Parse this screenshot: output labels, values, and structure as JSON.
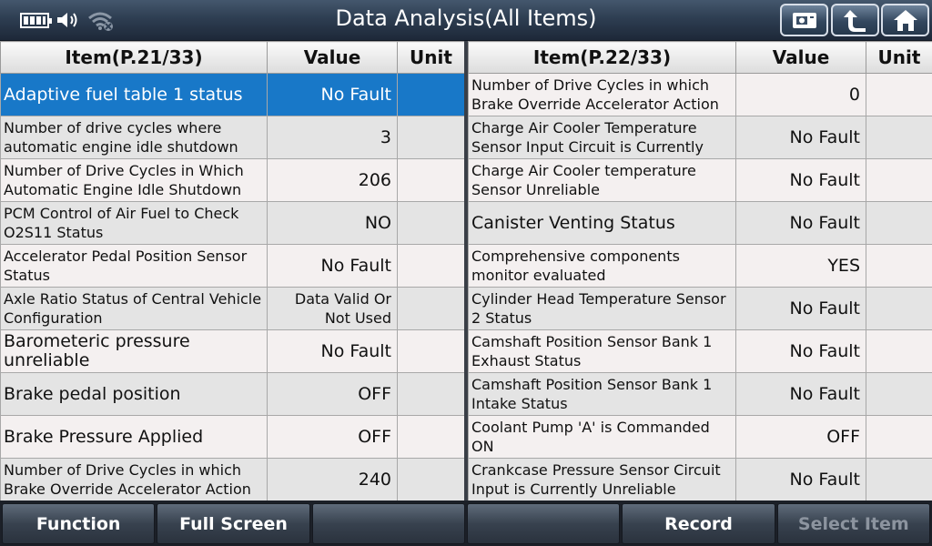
{
  "title": "Data Analysis(All Items)",
  "left_table": {
    "headers": {
      "item": "Item(P.21/33)",
      "value": "Value",
      "unit": "Unit"
    },
    "rows": [
      {
        "item": "Adaptive fuel table 1 status",
        "value": "No Fault",
        "unit": ""
      },
      {
        "item": "Number of drive cycles where automatic engine idle shutdown",
        "value": "3",
        "unit": ""
      },
      {
        "item": "Number of Drive Cycles in Which Automatic Engine Idle Shutdown",
        "value": "206",
        "unit": ""
      },
      {
        "item": "PCM Control of Air Fuel to Check O2S11 Status",
        "value": "NO",
        "unit": ""
      },
      {
        "item": "Accelerator Pedal Position Sensor Status",
        "value": "No Fault",
        "unit": ""
      },
      {
        "item": "Axle Ratio Status of Central Vehicle Configuration",
        "value": "Data Valid Or Not Used",
        "unit": ""
      },
      {
        "item": "Barometeric pressure unreliable",
        "value": "No Fault",
        "unit": ""
      },
      {
        "item": "Brake pedal position",
        "value": "OFF",
        "unit": ""
      },
      {
        "item": "Brake Pressure Applied",
        "value": "OFF",
        "unit": ""
      },
      {
        "item": "Number of Drive Cycles in which Brake Override Accelerator Action",
        "value": "240",
        "unit": ""
      }
    ]
  },
  "right_table": {
    "headers": {
      "item": "Item(P.22/33)",
      "value": "Value",
      "unit": "Unit"
    },
    "rows": [
      {
        "item": "Number of Drive Cycles in which Brake Override Accelerator Action",
        "value": "0",
        "unit": ""
      },
      {
        "item": "Charge Air Cooler Temperature Sensor Input Circuit is Currently",
        "value": "No Fault",
        "unit": ""
      },
      {
        "item": "Charge Air Cooler temperature Sensor Unreliable",
        "value": "No Fault",
        "unit": ""
      },
      {
        "item": "Canister Venting Status",
        "value": "No Fault",
        "unit": ""
      },
      {
        "item": "Comprehensive components monitor evaluated",
        "value": "YES",
        "unit": ""
      },
      {
        "item": "Cylinder Head Temperature Sensor 2 Status",
        "value": "No Fault",
        "unit": ""
      },
      {
        "item": "Camshaft Position Sensor Bank 1 Exhaust Status",
        "value": "No Fault",
        "unit": ""
      },
      {
        "item": "Camshaft Position Sensor Bank 1 Intake Status",
        "value": "No Fault",
        "unit": ""
      },
      {
        "item": "Coolant Pump 'A' is Commanded ON",
        "value": "OFF",
        "unit": ""
      },
      {
        "item": "Crankcase Pressure Sensor Circuit Input is Currently Unreliable",
        "value": "No Fault",
        "unit": ""
      }
    ]
  },
  "bottom_bar": {
    "function": "Function",
    "full_screen": "Full Screen",
    "empty1": "",
    "empty2": "",
    "record": "Record",
    "select_item": "Select Item"
  },
  "colors": {
    "selected_row": "#1878c8",
    "title_bar": "#2e3e52"
  },
  "icons": [
    "battery-icon",
    "speaker-icon",
    "wifi-icon",
    "screenshot-icon",
    "back-icon",
    "home-icon"
  ]
}
